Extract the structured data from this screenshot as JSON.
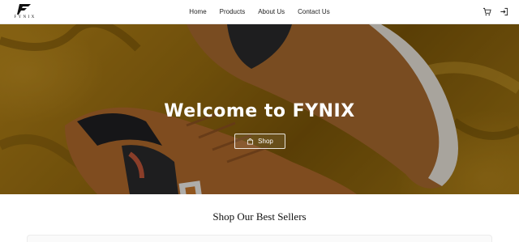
{
  "brand": {
    "name": "FYNIX"
  },
  "nav": {
    "links": [
      {
        "label": "Home"
      },
      {
        "label": "Products"
      },
      {
        "label": "About Us"
      },
      {
        "label": "Contact Us"
      }
    ],
    "icons": [
      "cart-icon",
      "login-icon"
    ]
  },
  "hero": {
    "title": "Welcome to FYNIX",
    "button_label": "Shop",
    "button_icon": "shopping-bag-icon"
  },
  "best_sellers": {
    "title": "Shop Our Best Sellers"
  },
  "colors": {
    "hero_yellow": "#b88618",
    "sneaker_tan": "#b06a2c",
    "text_dark": "#222222"
  }
}
